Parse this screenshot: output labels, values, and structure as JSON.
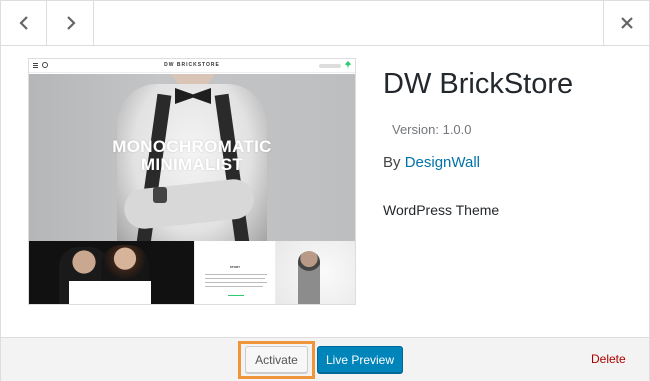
{
  "nav": {
    "prev_icon": "chevron-left-icon",
    "next_icon": "chevron-right-icon",
    "close_icon": "close-icon"
  },
  "screenshot": {
    "brand": "DW BRICKSTORE",
    "hero_line1": "MONOCHROMATIC",
    "hero_line2": "MINIMALIST",
    "story_heading": "STORY"
  },
  "theme": {
    "name": "DW BrickStore",
    "version": "Version: 1.0.0",
    "author_prefix": "By",
    "author": "DesignWall",
    "description": "WordPress Theme"
  },
  "actions": {
    "activate": "Activate",
    "live_preview": "Live Preview",
    "delete": "Delete"
  },
  "colors": {
    "primary_button": "#0085ba",
    "delete_link": "#aa0000",
    "highlight": "#f0953a",
    "author_link": "#0073aa"
  }
}
